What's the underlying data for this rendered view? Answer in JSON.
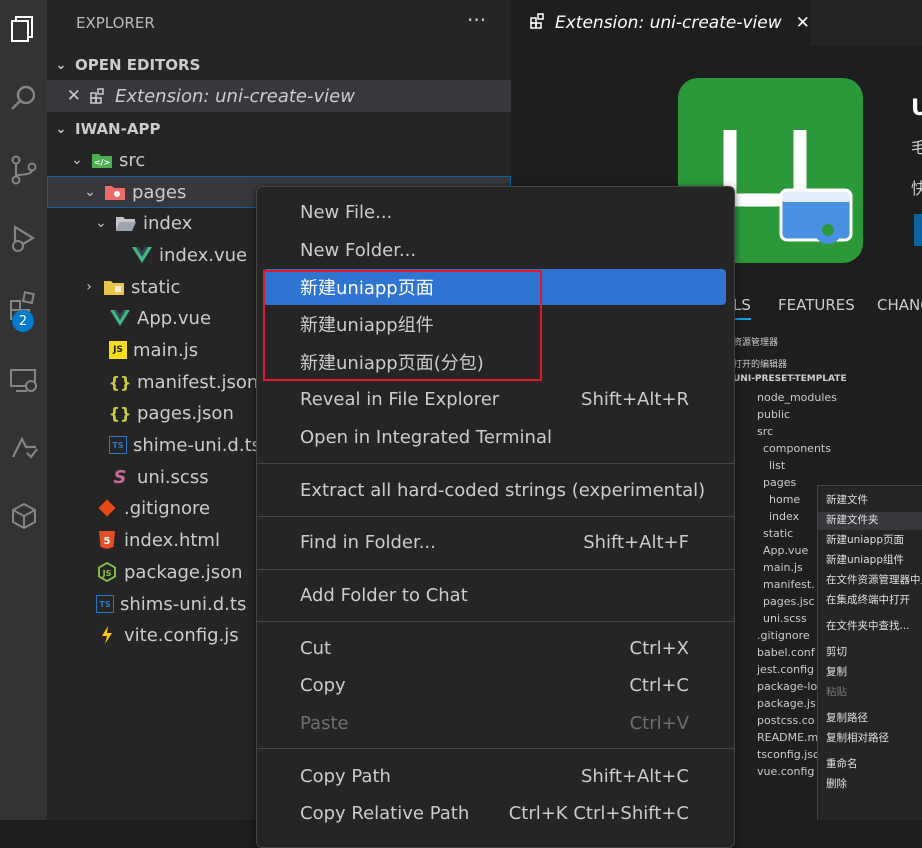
{
  "explorer": {
    "title": "EXPLORER",
    "more": "···",
    "open_editors_label": "OPEN EDITORS",
    "open_editor_item": "Extension: uni-create-view",
    "workspace_label": "IWAN-APP",
    "tree": [
      {
        "name": "src",
        "icon": "src-folder-icon"
      },
      {
        "name": "pages",
        "icon": "pages-folder-icon"
      },
      {
        "name": "index",
        "icon": "folder-open-icon"
      },
      {
        "name": "index.vue",
        "icon": "vue-icon"
      },
      {
        "name": "static",
        "icon": "folder-icon"
      },
      {
        "name": "App.vue",
        "icon": "vue-icon"
      },
      {
        "name": "main.js",
        "icon": "js-icon"
      },
      {
        "name": "manifest.json",
        "icon": "json-icon"
      },
      {
        "name": "pages.json",
        "icon": "json-icon"
      },
      {
        "name": "shime-uni.d.ts",
        "icon": "ts-icon"
      },
      {
        "name": "uni.scss",
        "icon": "scss-icon"
      },
      {
        "name": ".gitignore",
        "icon": "git-icon"
      },
      {
        "name": "index.html",
        "icon": "html-icon"
      },
      {
        "name": "package.json",
        "icon": "nodejs-icon"
      },
      {
        "name": "shims-uni.d.ts",
        "icon": "ts-icon"
      },
      {
        "name": "vite.config.js",
        "icon": "vite-icon"
      }
    ]
  },
  "activity_badge": "2",
  "editor": {
    "tab_label": "Extension: uni-create-view",
    "tab_close": "✕",
    "ext_tabs": [
      "LS",
      "FEATURES",
      "CHANG"
    ],
    "header_chars": [
      "U",
      "毛",
      "快"
    ]
  },
  "context_menu": {
    "items": [
      {
        "label": "New File...",
        "key": ""
      },
      {
        "label": "New Folder...",
        "key": ""
      },
      {
        "label": "新建uniapp页面",
        "key": ""
      },
      {
        "label": "新建uniapp组件",
        "key": ""
      },
      {
        "label": "新建uniapp页面(分包)",
        "key": ""
      },
      {
        "label": "Reveal in File Explorer",
        "key": "Shift+Alt+R"
      },
      {
        "label": "Open in Integrated Terminal",
        "key": ""
      },
      {
        "label": "Extract all hard-coded strings (experimental)",
        "key": ""
      },
      {
        "label": "Find in Folder...",
        "key": "Shift+Alt+F"
      },
      {
        "label": "Add Folder to Chat",
        "key": ""
      },
      {
        "label": "Cut",
        "key": "Ctrl+X"
      },
      {
        "label": "Copy",
        "key": "Ctrl+C"
      },
      {
        "label": "Paste",
        "key": "Ctrl+V"
      },
      {
        "label": "Copy Path",
        "key": "Shift+Alt+C"
      },
      {
        "label": "Copy Relative Path",
        "key": "Ctrl+K Ctrl+Shift+C"
      }
    ]
  },
  "preview": {
    "header": "资源管理器",
    "open_editors": "打开的编辑器",
    "project": "UNI-PRESET-TEMPLATE",
    "tree": [
      "node_modules",
      "public",
      "src",
      "components",
      "list",
      "pages",
      "home",
      "index",
      "static",
      "App.vue",
      "main.js",
      "manifest.",
      "pages.jsc",
      "uni.scss",
      ".gitignore",
      "babel.conf",
      "jest.config",
      "package-lo",
      "package.js",
      "postcss.co",
      "README.m",
      "tsconfig.jsc",
      "vue.config"
    ],
    "menu": [
      "新建文件",
      "新建文件夹",
      "新建uniapp页面",
      "新建uniapp组件",
      "在文件资源管理器中显",
      "在集成终端中打开",
      "在文件夹中查找...",
      "剪切",
      "复制",
      "粘贴",
      "复制路径",
      "复制相对路径",
      "重命名",
      "删除"
    ]
  }
}
